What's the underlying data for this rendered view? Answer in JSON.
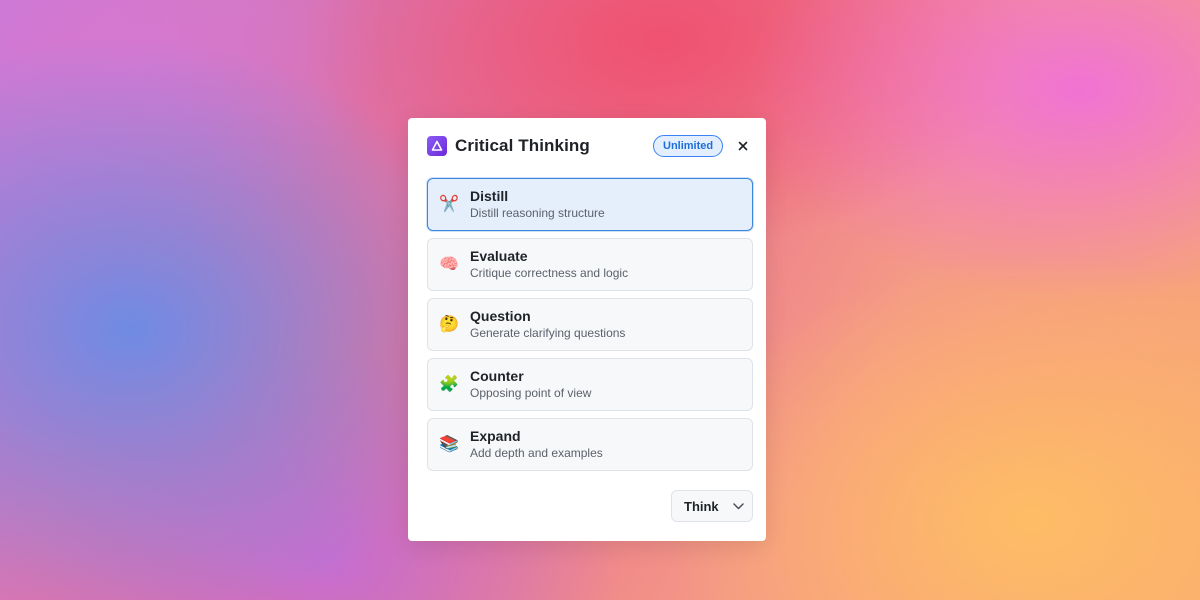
{
  "panel": {
    "title": "Critical Thinking",
    "logo_icon": "triangle-logo-icon",
    "badge": "Unlimited",
    "close_icon": "close-icon"
  },
  "items": [
    {
      "title": "Distill",
      "desc": "Distill reasoning structure",
      "icon": "✂️",
      "icon_name": "scissors-icon",
      "selected": true
    },
    {
      "title": "Evaluate",
      "desc": "Critique correctness and logic",
      "icon": "🧠",
      "icon_name": "brain-icon",
      "selected": false
    },
    {
      "title": "Question",
      "desc": "Generate clarifying questions",
      "icon": "🤔",
      "icon_name": "thinking-face-icon",
      "selected": false
    },
    {
      "title": "Counter",
      "desc": "Opposing point of view",
      "icon": "🧩",
      "icon_name": "puzzle-icon",
      "selected": false
    },
    {
      "title": "Expand",
      "desc": "Add depth and examples",
      "icon": "📚",
      "icon_name": "books-icon",
      "selected": false
    }
  ],
  "action": {
    "label": "Think",
    "icon": "chevron-down-icon"
  },
  "colors": {
    "accent": "#3b87e0",
    "badge_bg": "#e3efff",
    "badge_text": "#1d6fd8",
    "logo": "#7c3aed"
  }
}
